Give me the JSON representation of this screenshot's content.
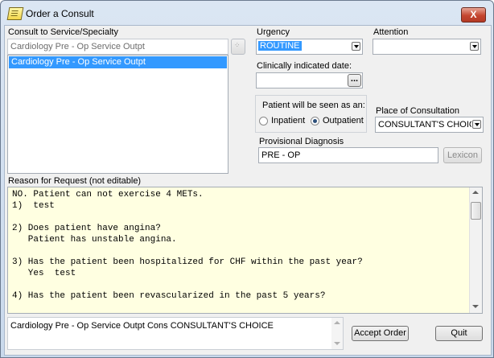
{
  "window": {
    "title": "Order a Consult",
    "close_label": "X"
  },
  "service": {
    "label": "Consult to Service/Specialty",
    "input_value": "Cardiology Pre - Op Service Outpt",
    "list_items": [
      "Cardiology Pre - Op Service Outpt"
    ]
  },
  "urgency": {
    "label": "Urgency",
    "value": "ROUTINE"
  },
  "attention": {
    "label": "Attention",
    "value": ""
  },
  "clinical_date": {
    "label": "Clinically indicated date:",
    "value": "",
    "button_label": "..."
  },
  "patient_seen": {
    "label": "Patient will be seen as an:",
    "options": [
      "Inpatient",
      "Outpatient"
    ],
    "selected": "Outpatient"
  },
  "place": {
    "label": "Place of Consultation",
    "value": "CONSULTANT'S CHOICE"
  },
  "diagnosis": {
    "label": "Provisional Diagnosis",
    "value": "PRE - OP",
    "lexicon_label": "Lexicon"
  },
  "reason": {
    "label": "Reason for Request  (not editable)",
    "lines": [
      "NO. Patient can not exercise 4 METs.",
      "1)  test",
      "",
      "2) Does patient have angina?",
      "   Patient has unstable angina.",
      "",
      "3) Has the patient been hospitalized for CHF within the past year?",
      "   Yes  test",
      "",
      "4) Has the patient been revascularized in the past 5 years?"
    ]
  },
  "summary": {
    "text": "Cardiology Pre - Op Service Outpt Cons CONSULTANT'S CHOICE"
  },
  "buttons": {
    "accept": "Accept Order",
    "quit": "Quit"
  }
}
